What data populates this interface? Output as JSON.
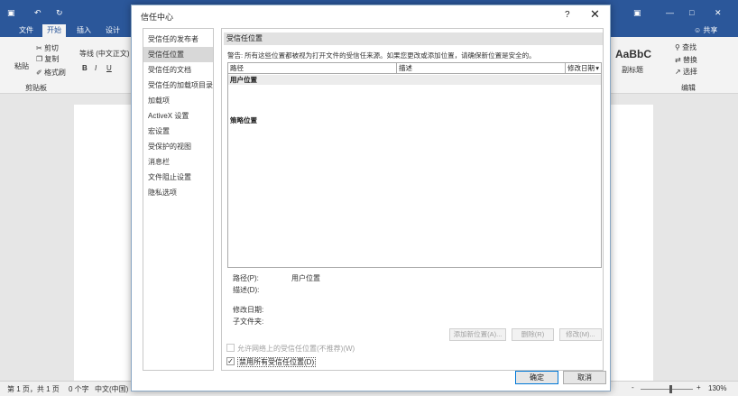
{
  "word": {
    "tabs": [
      "文件",
      "开始",
      "插入",
      "设计"
    ],
    "share": "共享",
    "ribbon": {
      "cut": "剪切",
      "copy": "复制",
      "paste": "粘贴",
      "format_painter": "格式刷",
      "clipboard_group": "剪贴板",
      "font_name": "等线 (中文正文)",
      "bold": "B",
      "italic": "I",
      "underline": "U",
      "style_sample": "AaBbC",
      "style_name": "副标题",
      "find": "查找",
      "replace": "替换",
      "select": "选择",
      "edit_group": "编辑"
    },
    "status": {
      "page": "第 1 页，共 1 页",
      "words": "0 个字",
      "language": "中文(中国)",
      "zoom_minus": "-",
      "zoom_plus": "+",
      "zoom": "130%"
    }
  },
  "dialog": {
    "title": "信任中心",
    "help": "?",
    "close": "✕",
    "nav": [
      {
        "label": "受信任的发布者",
        "selected": false
      },
      {
        "label": "受信任位置",
        "selected": true
      },
      {
        "label": "受信任的文档",
        "selected": false
      },
      {
        "label": "受信任的加载项目录",
        "selected": false
      },
      {
        "label": "加载项",
        "selected": false
      },
      {
        "label": "ActiveX 设置",
        "selected": false
      },
      {
        "label": "宏设置",
        "selected": false
      },
      {
        "label": "受保护的视图",
        "selected": false
      },
      {
        "label": "消息栏",
        "selected": false
      },
      {
        "label": "文件阻止设置",
        "selected": false
      },
      {
        "label": "隐私选项",
        "selected": false
      }
    ],
    "section_title": "受信任位置",
    "warning": "警告: 所有这些位置都被视为打开文件的受信任来源。如果您更改或添加位置，请确保新位置是安全的。",
    "table": {
      "columns": [
        "路径",
        "描述",
        "修改日期"
      ],
      "sort_indicator": "▾",
      "group_user": "用户位置",
      "group_policy": "策略位置"
    },
    "details": {
      "path_label": "路径(P):",
      "path_value": "用户位置",
      "desc_label": "描述(D):",
      "modified_label": "修改日期:",
      "subfolders_label": "子文件夹:"
    },
    "buttons": {
      "add": "添加新位置(A)...",
      "remove": "删除(R)",
      "modify": "修改(M)...",
      "ok": "确定",
      "cancel": "取消"
    },
    "checkboxes": {
      "allow_network": {
        "label": "允许网络上的受信任位置(不推荐)(W)",
        "checked": false,
        "enabled": false
      },
      "disable_all": {
        "label": "禁用所有受信任位置(D)",
        "checked": true,
        "enabled": true,
        "mark": "✓"
      }
    }
  }
}
